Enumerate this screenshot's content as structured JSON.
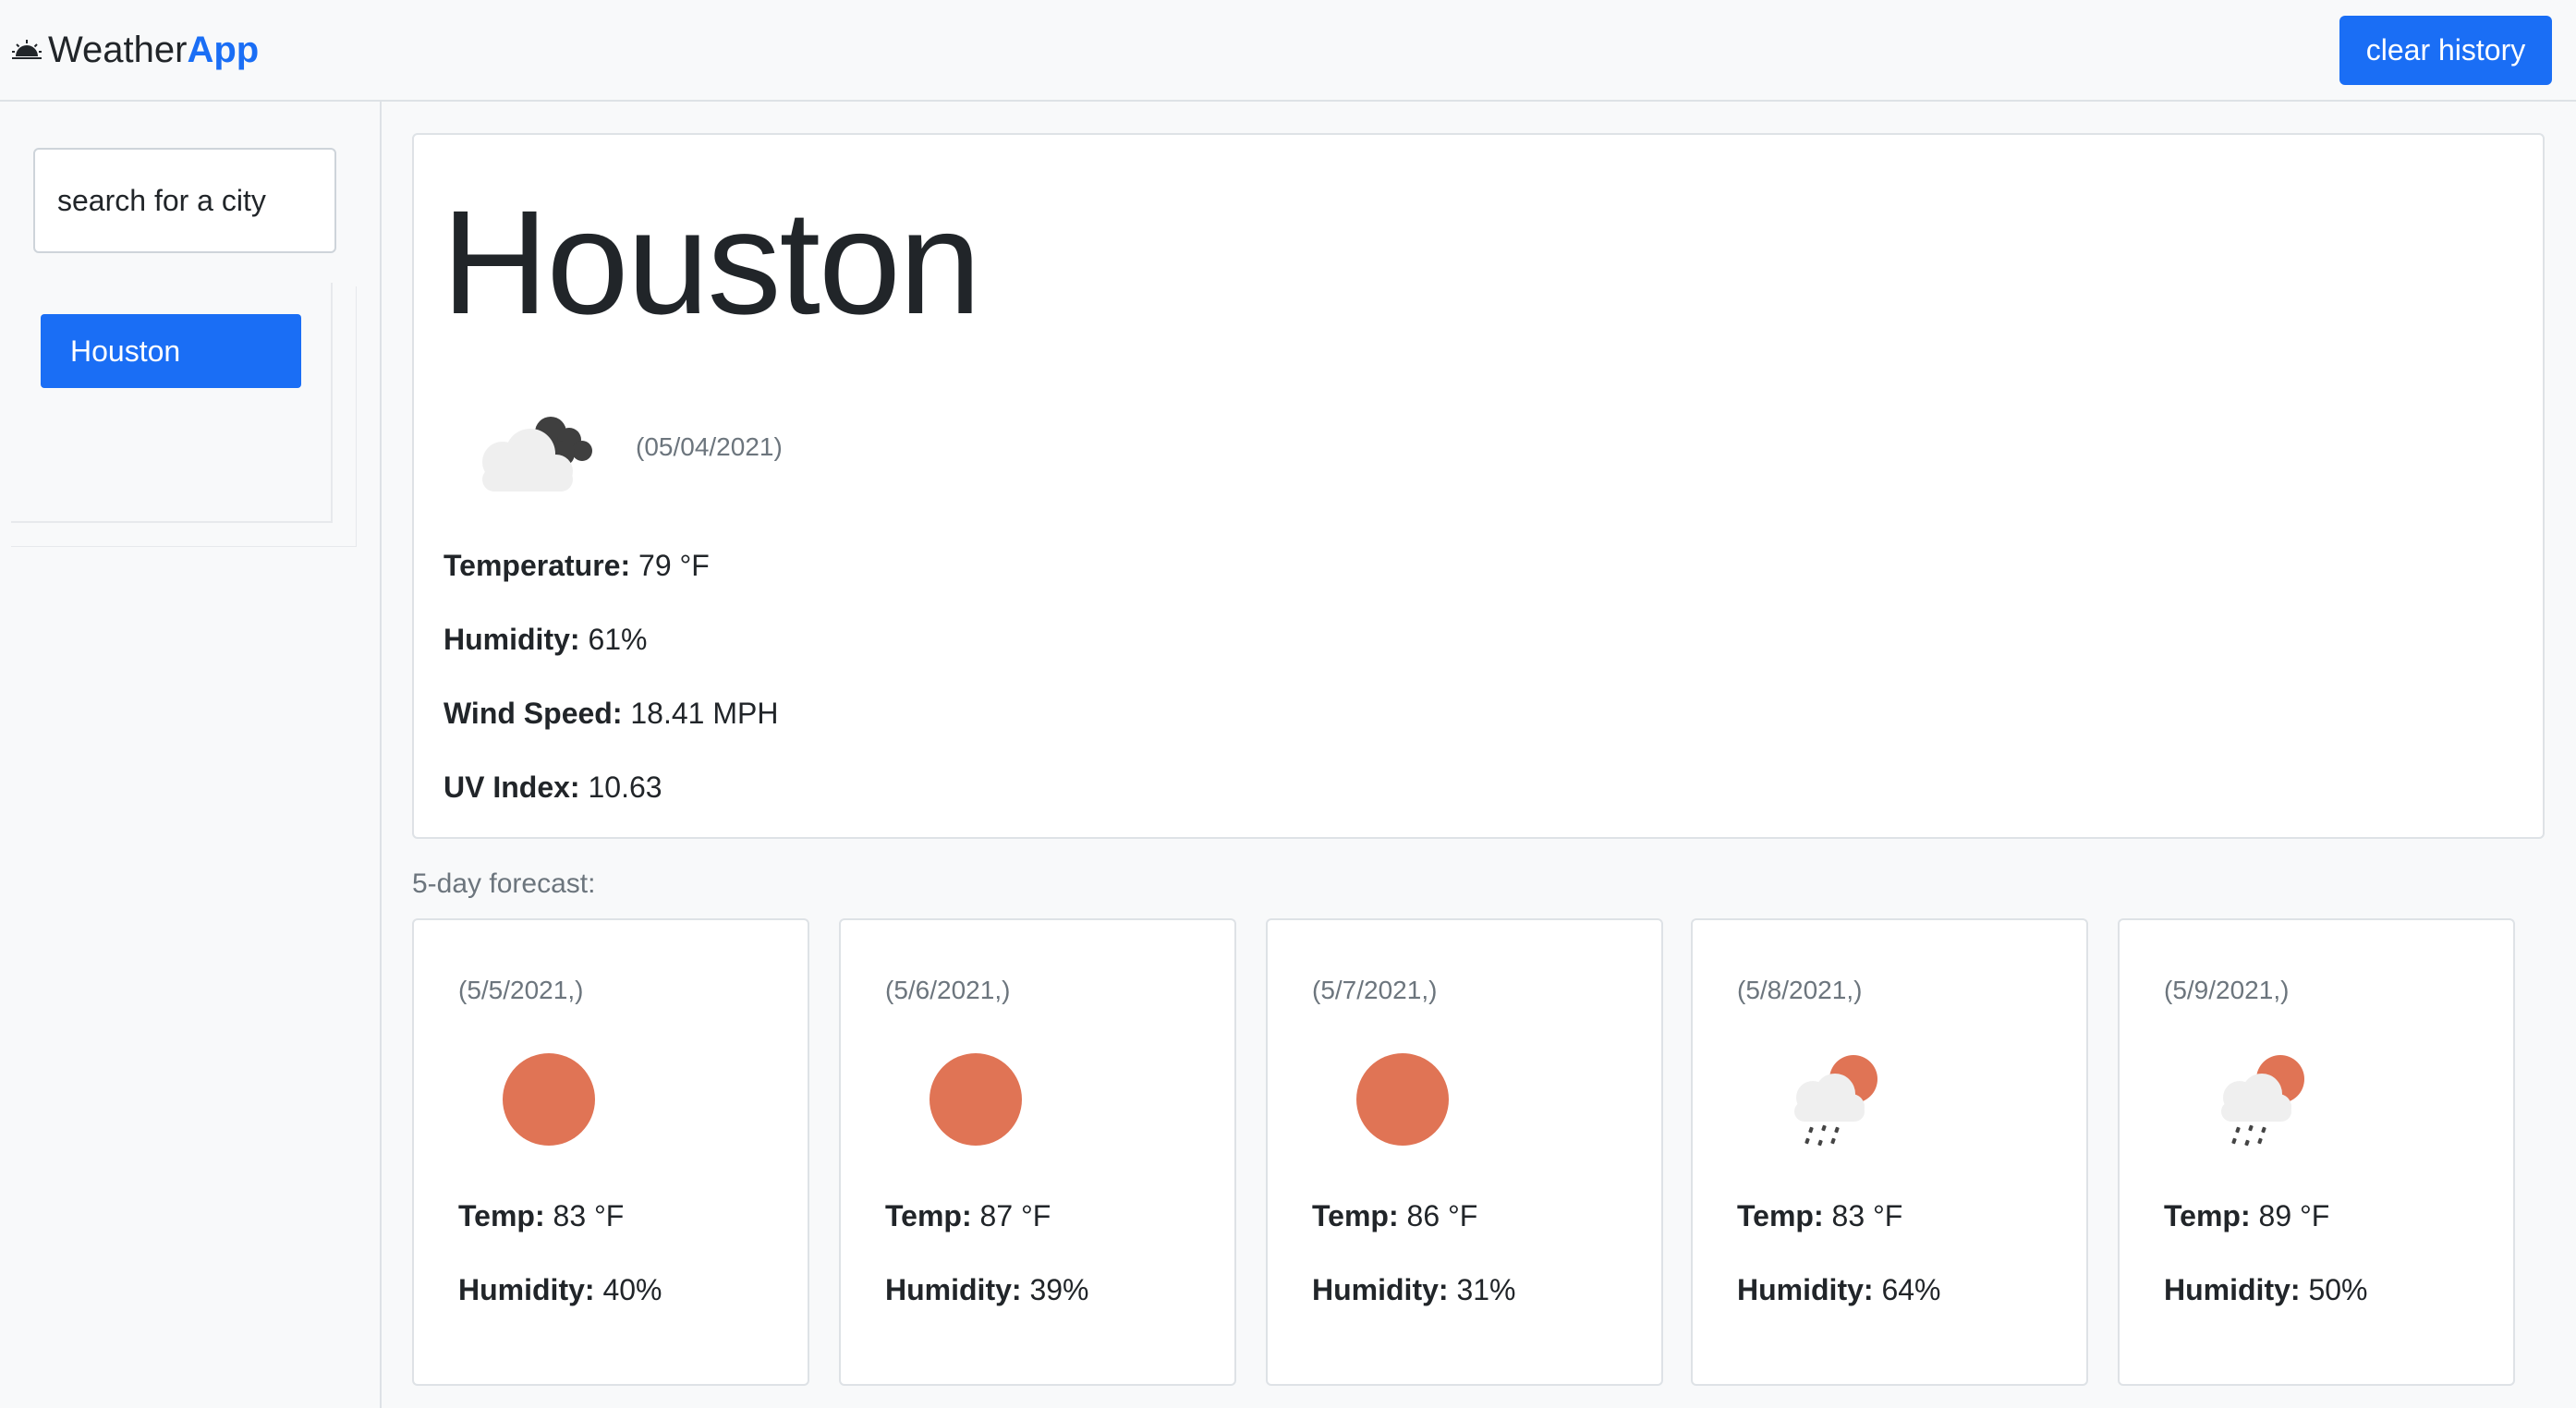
{
  "navbar": {
    "brand_part1": "Weather",
    "brand_part2": "App",
    "clear_label": "clear history",
    "logo_icon": "sunrise-icon"
  },
  "sidebar": {
    "search_placeholder": "search for a city",
    "history": [
      {
        "label": "Houston"
      }
    ]
  },
  "current": {
    "city": "Houston",
    "date": "(05/04/2021)",
    "icon": "broken-clouds-icon",
    "temperature_label": "Temperature:",
    "temperature_value": "79 °F",
    "humidity_label": "Humidity:",
    "humidity_value": "61%",
    "wind_label": "Wind Speed:",
    "wind_value": "18.41 MPH",
    "uv_label": "UV Index:",
    "uv_value": "10.63"
  },
  "forecast": {
    "heading": "5-day forecast:",
    "temp_label": "Temp:",
    "humidity_label": "Humidity:",
    "days": [
      {
        "date": "(5/5/2021,)",
        "icon": "sun-icon",
        "temp": "83 °F",
        "humidity": "40%"
      },
      {
        "date": "(5/6/2021,)",
        "icon": "sun-icon",
        "temp": "87 °F",
        "humidity": "39%"
      },
      {
        "date": "(5/7/2021,)",
        "icon": "sun-icon",
        "temp": "86 °F",
        "humidity": "31%"
      },
      {
        "date": "(5/8/2021,)",
        "icon": "sun-rain-cloud-icon",
        "temp": "83 °F",
        "humidity": "64%"
      },
      {
        "date": "(5/9/2021,)",
        "icon": "sun-rain-cloud-icon",
        "temp": "89 °F",
        "humidity": "50%"
      }
    ]
  },
  "colors": {
    "accent": "#1a6ef5",
    "sun": "#e07455",
    "muted_text": "#6c757d"
  }
}
